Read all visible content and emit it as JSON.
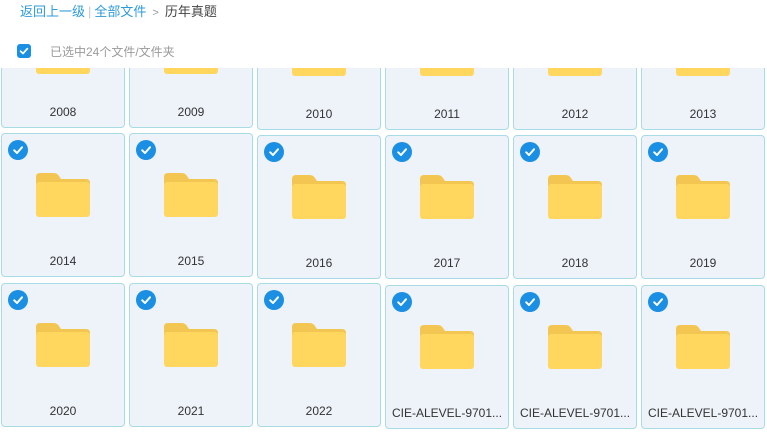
{
  "breadcrumb": {
    "back": "返回上一级",
    "root": "全部文件",
    "current": "历年真题"
  },
  "selection": {
    "text": "已选中24个文件/文件夹"
  },
  "colors": {
    "accent": "#1a8fe3",
    "link": "#2e9bd8",
    "tile_bg": "#eef3fa",
    "tile_border": "#a9dbe6",
    "folder_back": "#f2c650",
    "folder_front": "#ffd75e"
  },
  "icons": {
    "checkbox": "checkbox-checked-icon",
    "check": "check-circle-icon",
    "folder": "folder-icon"
  },
  "files": [
    {
      "name": "2008",
      "selected": true
    },
    {
      "name": "2009",
      "selected": true
    },
    {
      "name": "2010",
      "selected": true
    },
    {
      "name": "2011",
      "selected": true
    },
    {
      "name": "2012",
      "selected": true
    },
    {
      "name": "2013",
      "selected": true
    },
    {
      "name": "2014",
      "selected": true
    },
    {
      "name": "2015",
      "selected": true
    },
    {
      "name": "2016",
      "selected": true
    },
    {
      "name": "2017",
      "selected": true
    },
    {
      "name": "2018",
      "selected": true
    },
    {
      "name": "2019",
      "selected": true
    },
    {
      "name": "2020",
      "selected": true
    },
    {
      "name": "2021",
      "selected": true
    },
    {
      "name": "2022",
      "selected": true
    },
    {
      "name": "CIE-ALEVEL-9701...",
      "selected": true
    },
    {
      "name": "CIE-ALEVEL-9701...",
      "selected": true
    },
    {
      "name": "CIE-ALEVEL-9701...",
      "selected": true
    }
  ]
}
